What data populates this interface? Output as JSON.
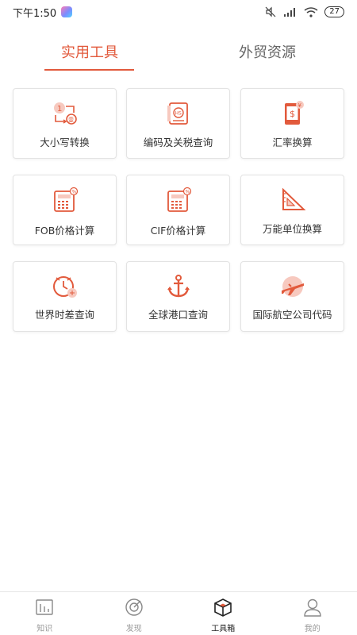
{
  "status_bar": {
    "time": "下午1:50",
    "battery": "27"
  },
  "tabs": [
    {
      "label": "实用工具",
      "active": true
    },
    {
      "label": "外贸资源",
      "active": false
    }
  ],
  "accent_color": "#e25a3c",
  "tools": [
    {
      "label": "大小写转换",
      "icon": "number-convert-icon"
    },
    {
      "label": "编码及关税查询",
      "icon": "hs-code-book-icon"
    },
    {
      "label": "汇率换算",
      "icon": "exchange-rate-tablet-icon"
    },
    {
      "label": "FOB价格计算",
      "icon": "calculator-icon"
    },
    {
      "label": "CIF价格计算",
      "icon": "calculator-icon"
    },
    {
      "label": "万能单位换算",
      "icon": "triangle-ruler-icon"
    },
    {
      "label": "世界时差查询",
      "icon": "world-clock-icon"
    },
    {
      "label": "全球港口查询",
      "icon": "anchor-icon"
    },
    {
      "label": "国际航空公司代码",
      "icon": "airplane-icon"
    }
  ],
  "bottom_nav": [
    {
      "label": "知识",
      "icon": "knowledge-icon",
      "active": false
    },
    {
      "label": "发现",
      "icon": "discover-icon",
      "active": false
    },
    {
      "label": "工具箱",
      "icon": "toolbox-icon",
      "active": true
    },
    {
      "label": "我的",
      "icon": "profile-icon",
      "active": false
    }
  ]
}
